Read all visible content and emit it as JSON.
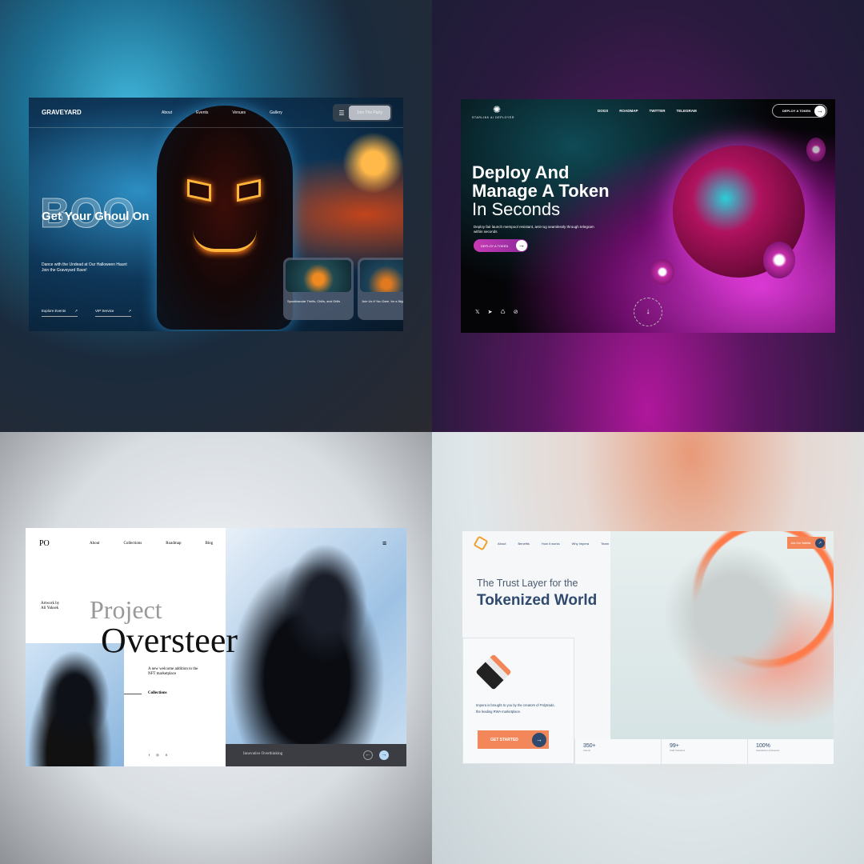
{
  "graveyard": {
    "logo": "GRAVEYARD",
    "nav": [
      "About",
      "Events",
      "Venues",
      "Gallery"
    ],
    "menu_icon": "hamburger-icon",
    "cta": "Join The Party",
    "outline_word": "BOO",
    "headline": "Get Your Ghoul On",
    "subtext": "Dance with the Undead at Our Halloween Haunt Join the Graveyard Rave!",
    "links": [
      "Explore Events",
      "VIP Service"
    ],
    "cards": [
      "Spooktacular Thrills, Chills, and Grills",
      "Join Us If You Dare, for a Night of Scares"
    ]
  },
  "starlink": {
    "logo": "STARLINK AI DEPLOYER",
    "nav": [
      "DOGS",
      "ROADMAP",
      "TWITTER",
      "TELEGRAM"
    ],
    "cta": "DEPLOY A TOKEN",
    "headline_1": "Deploy And",
    "headline_2": "Manage A Token",
    "headline_3": "In Seconds",
    "subtext": "Deploy fair launch mempool resistant, anti-rug seamlessly through telegram within seconds",
    "button": "DEPLOY A TOKEN",
    "social_icons": [
      "x-icon",
      "telegram-icon",
      "logo-icon",
      "link-icon"
    ],
    "scroll_icon": "arrow-down-icon"
  },
  "oversteer": {
    "logo": "PO",
    "nav": [
      "About",
      "Collections",
      "Roadmap",
      "Blog"
    ],
    "artwork_by": "Artwork by Ali Yuksek",
    "title_1": "Project",
    "title_2": "Oversteer",
    "description": "A new welcome addition to the NFT marketplace",
    "collections": "Collections",
    "socials": [
      "f",
      "◎",
      "X"
    ],
    "caption": "Innovative Overthinking"
  },
  "impera": {
    "nav": [
      "About",
      "Benefits",
      "How it works",
      "Why Impera",
      "Team"
    ],
    "cta": "Join Our Waitlist",
    "headline_1": "The Trust Layer for the",
    "headline_2": "Tokenized World",
    "description": "Impera is brought to you by the creators of Polytrade, the leading RWA marketplace.",
    "button": "GET STARTED",
    "stats": [
      {
        "value": "350+",
        "label": "Clients"
      },
      {
        "value": "99+",
        "label": "Staff Solutions"
      },
      {
        "value": "100%",
        "label": "Satisfaction & Results"
      }
    ],
    "accent": "#f4875a",
    "dark": "#2f4a6e"
  }
}
